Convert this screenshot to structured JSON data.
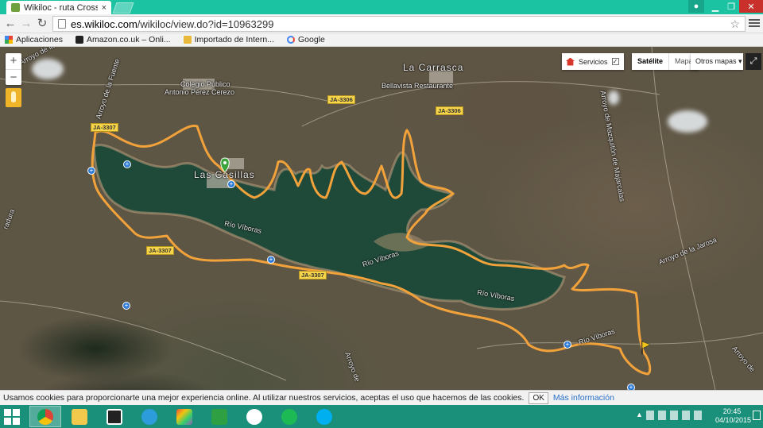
{
  "browser": {
    "tab_title": "Wikiloc - ruta Cross Panta",
    "tab_close": "×",
    "url_host": "es.wikiloc.com",
    "url_path": "/wikiloc/view.do?id=10963299"
  },
  "bookmarks": [
    {
      "label": "Aplicaciones",
      "icon": "apps-icon"
    },
    {
      "label": "Amazon.co.uk – Onli...",
      "icon": "amazon-icon"
    },
    {
      "label": "Importado de Intern...",
      "icon": "folder-icon"
    },
    {
      "label": "Google",
      "icon": "google-icon"
    }
  ],
  "map": {
    "zoom_in": "+",
    "zoom_out": "−",
    "services_label": "Servicios",
    "services_checked": "✓",
    "maptype_satellite": "Satélite",
    "maptype_map": "Mapa",
    "other_maps": "Otros mapas ▾",
    "fullscreen": "⤢",
    "labels": {
      "la_carrasca": "La Carrasca",
      "colegio": "Colegio Público",
      "colegio2": "Antonio Pérez Cerezo",
      "bellavista": "Bellavista Restaurante",
      "las_casillas": "Las Casillas",
      "rio_viboras_1": "Río Víboras",
      "rio_viboras_2": "Río Víboras",
      "rio_viboras_3": "Río Víboras",
      "rio_viboras_4": "Río Víboras",
      "arroyo_fuente": "Arroyo de la Fuente",
      "arroyo_mazquiton": "Arroyo de Mazquitón de Majarcalas",
      "arroyo_jarosa": "Arroyo de la Jarosa",
      "arroyo_top_left": "Arroyo de la",
      "arroyo_bottom": "Arroyo de",
      "arroyo_bottom_right": "Arroyo de",
      "radura": "radura",
      "ja3306_a": "JA-3306",
      "ja3306_b": "JA-3306",
      "ja3307_a": "JA-3307",
      "ja3307_b": "JA-3307",
      "ja3307_c": "JA-3307"
    }
  },
  "cookie": {
    "message": "Usamos cookies para proporcionarte una mejor experiencia online. Al utilizar nuestros servicios, aceptas el uso que hacemos de las cookies.",
    "ok": "OK",
    "more": "Más información"
  },
  "taskbar": {
    "time": "20:45",
    "date": "04/10/2015"
  },
  "colors": {
    "route": "#f2a23a",
    "water": "#1f4a3a",
    "accent": "#1cc3a3"
  }
}
